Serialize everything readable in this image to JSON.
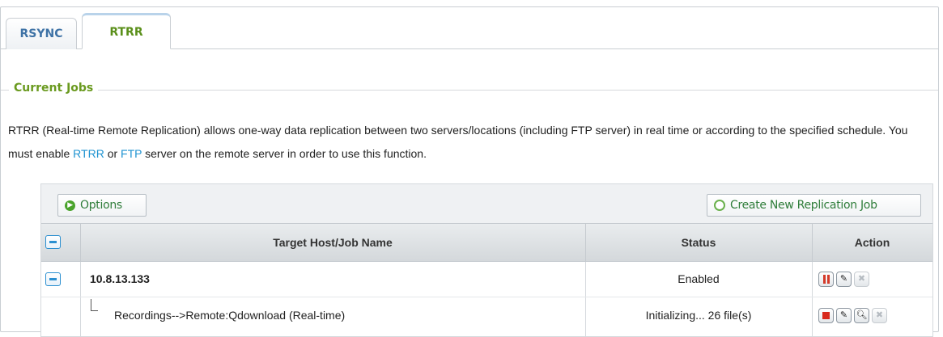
{
  "tabs": [
    {
      "label": "RSYNC",
      "active": false
    },
    {
      "label": "RTRR",
      "active": true
    }
  ],
  "section": {
    "legend": "Current Jobs",
    "description_part1": "RTRR (Real-time Remote Replication) allows one-way data replication between two servers/locations (including FTP server) in real time or according to the specified schedule. You must enable ",
    "link_rtrr": "RTRR",
    "description_or": " or ",
    "link_ftp": "FTP",
    "description_part2": " server on the remote server in order to use this function."
  },
  "toolbar": {
    "options_label": "Options",
    "create_label": "Create New Replication Job"
  },
  "table": {
    "columns": [
      "Target Host/Job Name",
      "Status",
      "Action"
    ],
    "host": {
      "name": "10.8.13.133",
      "status": "Enabled",
      "actions": [
        "pause-icon",
        "edit-icon",
        "delete-icon"
      ]
    },
    "job": {
      "name": "Recordings-->Remote:Qdownload (Real-time)",
      "status": "Initializing... 26 file(s)",
      "actions": [
        "stop-icon",
        "edit-icon",
        "view-log-icon",
        "delete-icon"
      ]
    }
  },
  "colors": {
    "active_tab_text": "#5a8f1a",
    "inactive_tab_text": "#3f73a6",
    "legend": "#6a9a1f",
    "link": "#1f93d1",
    "button_text": "#2f7d3a",
    "stop_red": "#d8291c"
  }
}
